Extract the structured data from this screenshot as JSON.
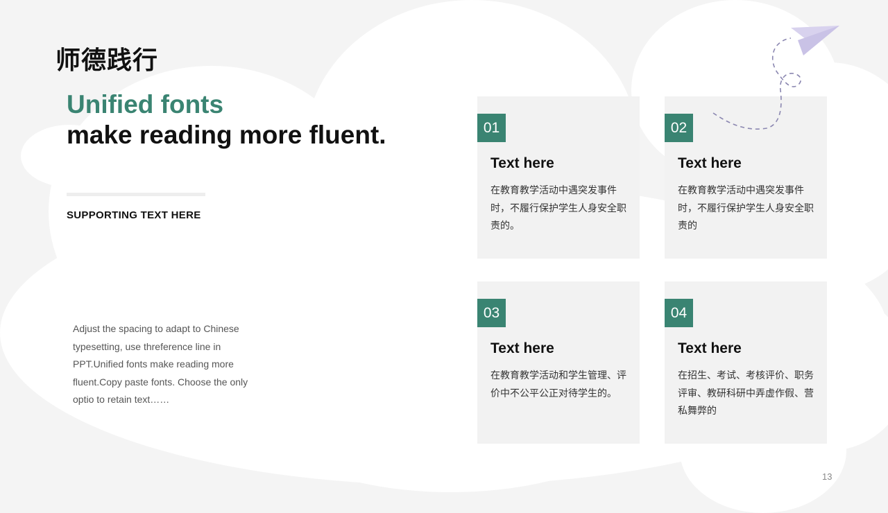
{
  "slide": {
    "title": "师德践行",
    "headline_accent": "Unified fonts",
    "headline_main": "make reading more fluent.",
    "supporting_text": "SUPPORTING TEXT HERE",
    "body_text": "Adjust the spacing to adapt to Chinese typesetting, use threference line in PPT.Unified fonts make reading more fluent.Copy paste fonts. Choose the only optio to retain text……",
    "page_number": "13"
  },
  "cards": [
    {
      "number": "01",
      "title": "Text here",
      "description": "在教育教学活动中遇突发事件时，不履行保护学生人身安全职责的。"
    },
    {
      "number": "02",
      "title": "Text here",
      "description": "在教育教学活动中遇突发事件时，不履行保护学生人身安全职责的"
    },
    {
      "number": "03",
      "title": "Text here",
      "description": "在教育教学活动和学生管理、评价中不公平公正对待学生的。"
    },
    {
      "number": "04",
      "title": "Text here",
      "description": "在招生、考试、考核评价、职务评审、教研科研中弄虚作假、营私舞弊的"
    }
  ],
  "colors": {
    "accent": "#3a8472",
    "background": "#f4f4f4",
    "card_background": "#f2f2f2",
    "plane": "#c9c2e6",
    "plane_trail": "#8a86b0"
  },
  "icons": {
    "decoration": "paper-plane-icon"
  }
}
